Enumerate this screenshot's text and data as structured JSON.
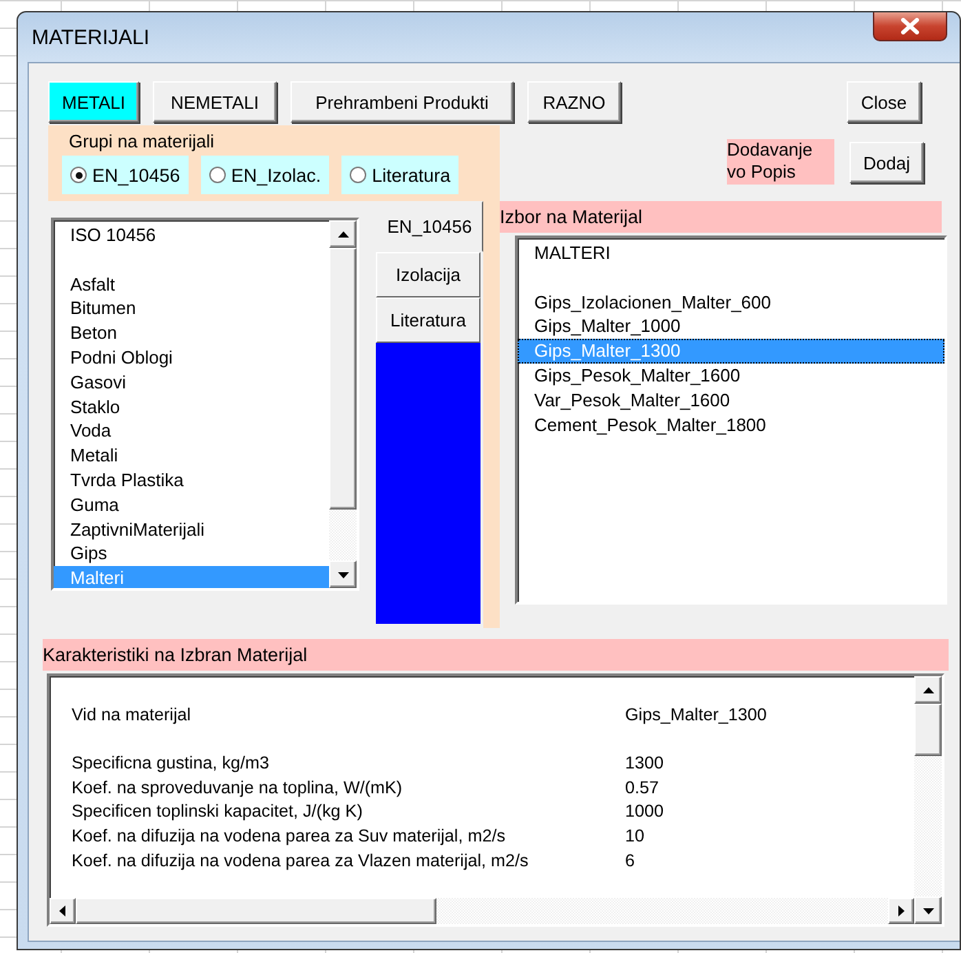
{
  "window": {
    "title": "MATERIJALI"
  },
  "category_buttons": [
    {
      "label": "METALI",
      "selected": true
    },
    {
      "label": "NEMETALI",
      "selected": false
    },
    {
      "label": "Prehrambeni Produkti",
      "selected": false
    },
    {
      "label": "RAZNO",
      "selected": false
    }
  ],
  "close_button": "Close",
  "material_groups": {
    "label": "Grupi na materijali",
    "options": [
      {
        "label": "EN_10456",
        "selected": true
      },
      {
        "label": "EN_Izolac.",
        "selected": false
      },
      {
        "label": "Literatura",
        "selected": false
      }
    ]
  },
  "add_label": "Dodavanje vo Popis",
  "add_button": "Dodaj",
  "category_list": {
    "items": [
      {
        "label": "ISO 10456",
        "kind": "heading",
        "selected": false
      },
      {
        "label": "Asfalt",
        "kind": "item",
        "selected": false
      },
      {
        "label": "Bitumen",
        "kind": "item",
        "selected": false
      },
      {
        "label": "Beton",
        "kind": "item",
        "selected": false
      },
      {
        "label": "Podni Oblogi",
        "kind": "item",
        "selected": false
      },
      {
        "label": "Gasovi",
        "kind": "item",
        "selected": false
      },
      {
        "label": "Staklo",
        "kind": "item",
        "selected": false
      },
      {
        "label": "Voda",
        "kind": "item",
        "selected": false
      },
      {
        "label": "Metali",
        "kind": "item",
        "selected": false
      },
      {
        "label": "Tvrda Plastika",
        "kind": "item",
        "selected": false
      },
      {
        "label": "Guma",
        "kind": "item",
        "selected": false
      },
      {
        "label": "ZaptivniMaterijali",
        "kind": "item",
        "selected": false
      },
      {
        "label": "Gips",
        "kind": "item",
        "selected": false
      },
      {
        "label": "Malteri",
        "kind": "item",
        "selected": true
      }
    ]
  },
  "side_tabs": [
    {
      "label": "EN_10456",
      "selected": true
    },
    {
      "label": "Izolacija",
      "selected": false
    },
    {
      "label": "Literatura",
      "selected": false
    }
  ],
  "material_list": {
    "title": "Izbor na Materijal",
    "items": [
      {
        "label": "MALTERI",
        "kind": "heading",
        "selected": false
      },
      {
        "label": "Gips_Izolacionen_Malter_600",
        "kind": "item",
        "selected": false
      },
      {
        "label": "Gips_Malter_1000",
        "kind": "item",
        "selected": false
      },
      {
        "label": "Gips_Malter_1300",
        "kind": "item",
        "selected": true
      },
      {
        "label": "Gips_Pesok_Malter_1600",
        "kind": "item",
        "selected": false
      },
      {
        "label": "Var_Pesok_Malter_1600",
        "kind": "item",
        "selected": false
      },
      {
        "label": "Cement_Pesok_Malter_1800",
        "kind": "item",
        "selected": false
      }
    ]
  },
  "properties": {
    "title": "Karakteristiki na Izbran Materijal",
    "rows": [
      {
        "label": "Vid na materijal",
        "value": "Gips_Malter_1300",
        "kind": "heading"
      },
      {
        "label": "Specificna gustina, kg/m3",
        "value": "1300",
        "kind": "item"
      },
      {
        "label": "Koef. na sproveduvanje na toplina, W/(mK)",
        "value": "0.57",
        "kind": "item"
      },
      {
        "label": "Specificen toplinski kapacitet, J/(kg K)",
        "value": "1000",
        "kind": "item"
      },
      {
        "label": "Koef. na difuzija na vodena parea za Suv materijal, m2/s",
        "value": "10",
        "kind": "item"
      },
      {
        "label": "Koef. na difuzija na vodena parea za Vlazen materijal, m2/s",
        "value": "6",
        "kind": "item"
      }
    ]
  }
}
